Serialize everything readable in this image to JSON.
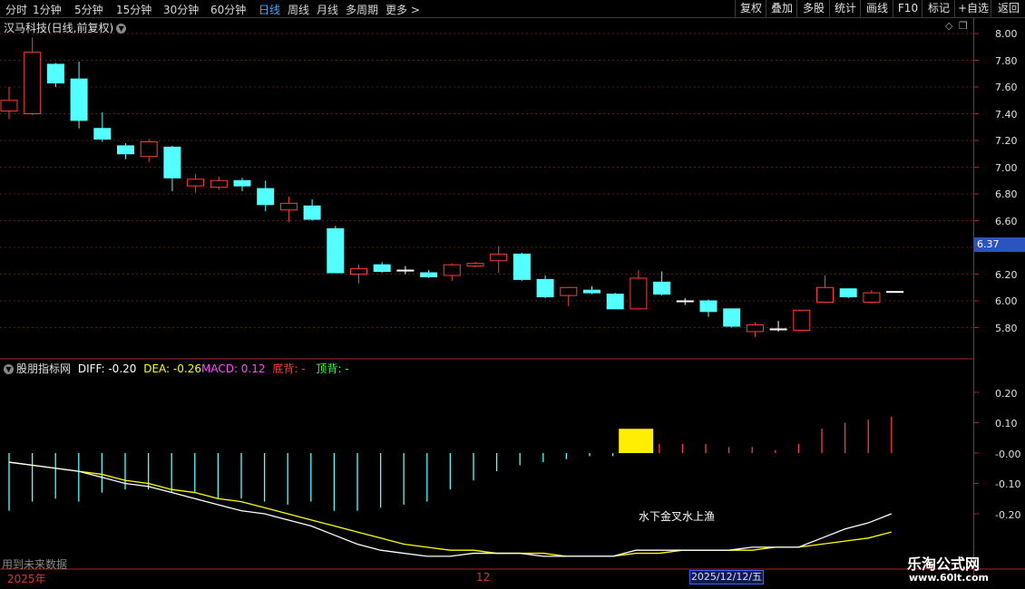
{
  "toolbar": {
    "periods": [
      "分时",
      "1分钟",
      "5分钟",
      "15分钟",
      "30分钟",
      "60分钟",
      "日线",
      "周线",
      "月线",
      "多周期",
      "更多 >"
    ],
    "active_period": "日线",
    "right_buttons": [
      "复权",
      "叠加",
      "多股",
      "统计",
      "画线",
      "F10",
      "标记",
      "+自选",
      "返回"
    ]
  },
  "main_chart": {
    "title": "汉马科技(日线,前复权)",
    "current_price_tag": "6.37",
    "y_ticks": [
      "8.00",
      "7.80",
      "7.60",
      "7.40",
      "7.20",
      "7.00",
      "6.80",
      "6.60",
      "6.40",
      "6.20",
      "6.00",
      "5.80"
    ]
  },
  "indicator": {
    "name": "股朋指标网",
    "diff_label": "DIFF: -0.20",
    "dea_label": "DEA: -0.26",
    "macd_label": "MACD: 0.12",
    "bottom_div_label": "底背: -",
    "top_div_label": "顶背: -",
    "y_ticks": [
      "0.20",
      "0.10",
      "-0.00",
      "-0.10",
      "-0.20"
    ],
    "annotation": "水下金叉水上渔"
  },
  "footer": {
    "year_label": "2025年",
    "month_label": "12",
    "date_box": "2025/12/12/五",
    "future_label": "用到未来数据"
  },
  "watermark": {
    "line1": "乐淘公式网",
    "line2": "www.60lt.com"
  },
  "colors": {
    "up": "#ff3c3c",
    "down": "#54ffff",
    "diff": "#ffffff",
    "dea": "#ffff00",
    "highlight": "#ffee00",
    "axis": "#b02020"
  },
  "chart_data": {
    "type": "candlestick",
    "ylim": [
      5.7,
      8.05
    ],
    "candles": [
      {
        "o": 7.42,
        "c": 7.5,
        "h": 7.6,
        "l": 7.36
      },
      {
        "o": 7.4,
        "c": 7.86,
        "h": 7.97,
        "l": 7.39
      },
      {
        "o": 7.77,
        "c": 7.63,
        "h": 7.78,
        "l": 7.6
      },
      {
        "o": 7.66,
        "c": 7.35,
        "h": 7.79,
        "l": 7.29
      },
      {
        "o": 7.29,
        "c": 7.21,
        "h": 7.41,
        "l": 7.19
      },
      {
        "o": 7.16,
        "c": 7.1,
        "h": 7.18,
        "l": 7.06
      },
      {
        "o": 7.08,
        "c": 7.19,
        "h": 7.21,
        "l": 7.04
      },
      {
        "o": 7.15,
        "c": 6.92,
        "h": 7.16,
        "l": 6.82
      },
      {
        "o": 6.86,
        "c": 6.91,
        "h": 6.95,
        "l": 6.81
      },
      {
        "o": 6.85,
        "c": 6.9,
        "h": 6.93,
        "l": 6.83
      },
      {
        "o": 6.9,
        "c": 6.86,
        "h": 6.92,
        "l": 6.82
      },
      {
        "o": 6.84,
        "c": 6.72,
        "h": 6.9,
        "l": 6.67
      },
      {
        "o": 6.68,
        "c": 6.73,
        "h": 6.78,
        "l": 6.59
      },
      {
        "o": 6.71,
        "c": 6.61,
        "h": 6.76,
        "l": 6.6
      },
      {
        "o": 6.54,
        "c": 6.21,
        "h": 6.56,
        "l": 6.21
      },
      {
        "o": 6.2,
        "c": 6.24,
        "h": 6.27,
        "l": 6.13
      },
      {
        "o": 6.27,
        "c": 6.22,
        "h": 6.29,
        "l": 6.21
      },
      {
        "o": 6.23,
        "c": 6.23,
        "h": 6.26,
        "l": 6.2
      },
      {
        "o": 6.21,
        "c": 6.18,
        "h": 6.23,
        "l": 6.17
      },
      {
        "o": 6.19,
        "c": 6.27,
        "h": 6.28,
        "l": 6.15
      },
      {
        "o": 6.26,
        "c": 6.28,
        "h": 6.29,
        "l": 6.25
      },
      {
        "o": 6.3,
        "c": 6.35,
        "h": 6.41,
        "l": 6.21
      },
      {
        "o": 6.35,
        "c": 6.16,
        "h": 6.36,
        "l": 6.15
      },
      {
        "o": 6.16,
        "c": 6.03,
        "h": 6.19,
        "l": 6.02
      },
      {
        "o": 6.04,
        "c": 6.1,
        "h": 6.1,
        "l": 5.96
      },
      {
        "o": 6.08,
        "c": 6.06,
        "h": 6.11,
        "l": 6.05
      },
      {
        "o": 6.05,
        "c": 5.94,
        "h": 6.06,
        "l": 5.94
      },
      {
        "o": 5.94,
        "c": 6.17,
        "h": 6.23,
        "l": 5.94
      },
      {
        "o": 6.14,
        "c": 6.05,
        "h": 6.22,
        "l": 6.04
      },
      {
        "o": 6.0,
        "c": 6.0,
        "h": 6.02,
        "l": 5.97
      },
      {
        "o": 6.0,
        "c": 5.92,
        "h": 6.01,
        "l": 5.88
      },
      {
        "o": 5.94,
        "c": 5.81,
        "h": 5.94,
        "l": 5.8
      },
      {
        "o": 5.77,
        "c": 5.82,
        "h": 5.84,
        "l": 5.73
      },
      {
        "o": 5.79,
        "c": 5.79,
        "h": 5.85,
        "l": 5.77
      },
      {
        "o": 5.78,
        "c": 5.93,
        "h": 5.93,
        "l": 5.78
      },
      {
        "o": 5.99,
        "c": 6.1,
        "h": 6.19,
        "l": 5.99
      },
      {
        "o": 6.09,
        "c": 6.03,
        "h": 6.09,
        "l": 6.02
      },
      {
        "o": 5.99,
        "c": 6.06,
        "h": 6.08,
        "l": 5.98
      },
      {
        "o": 6.07,
        "c": 6.07,
        "h": 6.07,
        "l": 6.07
      }
    ],
    "macd_ylim": [
      -0.38,
      0.3
    ],
    "macd_bars": [
      -0.19,
      -0.16,
      -0.15,
      -0.16,
      -0.13,
      -0.12,
      -0.12,
      -0.13,
      -0.13,
      -0.15,
      -0.15,
      -0.16,
      -0.17,
      -0.16,
      -0.19,
      -0.19,
      -0.18,
      -0.17,
      -0.16,
      -0.12,
      -0.09,
      -0.06,
      -0.04,
      -0.03,
      -0.02,
      -0.01,
      -0.01,
      0.08,
      0.03,
      0.03,
      0.03,
      0.02,
      0.02,
      0.01,
      0.03,
      0.08,
      0.1,
      0.11,
      0.12
    ],
    "highlight_bar_index": 27,
    "diff": [
      -0.03,
      -0.04,
      -0.05,
      -0.06,
      -0.08,
      -0.1,
      -0.11,
      -0.13,
      -0.15,
      -0.17,
      -0.19,
      -0.2,
      -0.22,
      -0.24,
      -0.27,
      -0.3,
      -0.32,
      -0.33,
      -0.34,
      -0.34,
      -0.33,
      -0.33,
      -0.33,
      -0.34,
      -0.34,
      -0.34,
      -0.34,
      -0.32,
      -0.32,
      -0.32,
      -0.32,
      -0.32,
      -0.31,
      -0.31,
      -0.31,
      -0.28,
      -0.25,
      -0.23,
      -0.2
    ],
    "dea": [
      -0.03,
      -0.04,
      -0.05,
      -0.06,
      -0.07,
      -0.09,
      -0.1,
      -0.12,
      -0.13,
      -0.15,
      -0.16,
      -0.18,
      -0.2,
      -0.22,
      -0.24,
      -0.26,
      -0.28,
      -0.3,
      -0.31,
      -0.32,
      -0.32,
      -0.33,
      -0.33,
      -0.33,
      -0.34,
      -0.34,
      -0.34,
      -0.33,
      -0.33,
      -0.32,
      -0.32,
      -0.32,
      -0.32,
      -0.31,
      -0.31,
      -0.3,
      -0.29,
      -0.28,
      -0.26
    ]
  }
}
